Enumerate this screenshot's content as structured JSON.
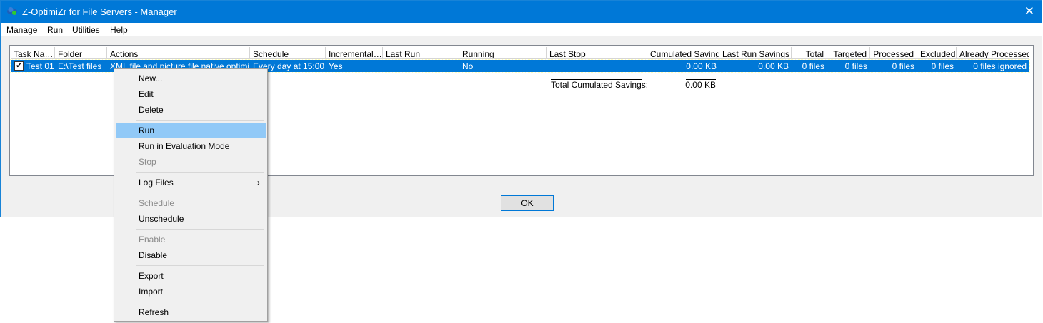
{
  "window": {
    "title": "Z-OptimiZr for File Servers - Manager"
  },
  "menu": [
    "Manage",
    "Run",
    "Utilities",
    "Help"
  ],
  "columns": [
    "Task Na…",
    "Folder",
    "Actions",
    "Schedule",
    "Incremental…",
    "Last Run",
    "Running",
    "Last Stop",
    "Cumulated Savings",
    "Last Run Savings",
    "Total",
    "Targeted",
    "Processed",
    "Excluded",
    "Already Processed"
  ],
  "rows": [
    {
      "checked": true,
      "cells": [
        "Test 01",
        "E:\\Test files",
        "XML file and picture file native optimi…",
        "Every day at 15:00",
        "Yes",
        "",
        "No",
        "",
        "0.00 KB",
        "0.00 KB",
        "0 files",
        "0 files",
        "0 files",
        "0 files",
        "0 files ignored"
      ]
    }
  ],
  "totals": {
    "label": "Total Cumulated Savings:",
    "value": "0.00 KB"
  },
  "ok_label": "OK",
  "context_menu": [
    {
      "label": "New...",
      "state": "normal"
    },
    {
      "label": "Edit",
      "state": "normal"
    },
    {
      "label": "Delete",
      "state": "normal"
    },
    {
      "label": "Run",
      "state": "highlighted"
    },
    {
      "label": "Run in Evaluation Mode",
      "state": "normal"
    },
    {
      "label": "Stop",
      "state": "disabled"
    },
    {
      "label": "Log Files",
      "state": "normal",
      "submenu": true
    },
    {
      "label": "Schedule",
      "state": "disabled"
    },
    {
      "label": "Unschedule",
      "state": "normal"
    },
    {
      "label": "Enable",
      "state": "disabled"
    },
    {
      "label": "Disable",
      "state": "normal"
    },
    {
      "label": "Export",
      "state": "normal"
    },
    {
      "label": "Import",
      "state": "normal"
    },
    {
      "label": "Refresh",
      "state": "normal"
    }
  ]
}
